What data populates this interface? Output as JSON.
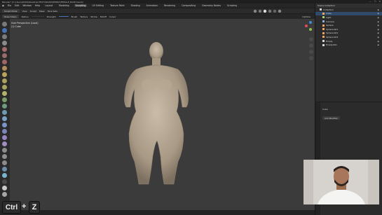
{
  "window": {
    "title": "Blender* [C:\\Users\\DUMA\\Desktop\\TEXTURA\\MUDERNO\\FEMALE_BASE.blend]",
    "controls": [
      "—",
      "☐",
      "✕"
    ]
  },
  "menu": {
    "items": [
      "File",
      "Edit",
      "Window",
      "Help"
    ],
    "workspaces": [
      "Layout",
      "Modeling",
      "Sculpting",
      "UV Editing",
      "Texture Paint",
      "Shading",
      "Animation",
      "Rendering",
      "Compositing",
      "Geometry Nodes",
      "Scripting"
    ],
    "active_workspace": "Sculpting",
    "scene": "Scene",
    "view_layer": "ViewLayer"
  },
  "header1": {
    "mode": "Sculpt Mode",
    "items": [
      "View",
      "Sculpt",
      "Mask",
      "Face Sets"
    ]
  },
  "header2": {
    "brush": "Draw Sharp",
    "radius_label": "Radius",
    "strength_label": "Strength",
    "items": [
      "Brush",
      "Texture",
      "Stroke",
      "Falloff",
      "Cursor"
    ],
    "view_label": "Options"
  },
  "viewport": {
    "info_line1": "User Perspective (Local)",
    "info_line2": "(1) Cube"
  },
  "outliner": {
    "title": "Scene Collection",
    "rows": [
      {
        "label": "Collection",
        "icon_color": "#d4d4d4",
        "selected": false
      },
      {
        "label": "Cube",
        "icon_color": "#f0a35e",
        "selected": true
      },
      {
        "label": "Light",
        "icon_color": "#a8d27a",
        "selected": false
      },
      {
        "label": "Camera",
        "icon_color": "#8fb1d8",
        "selected": false
      },
      {
        "label": "Sphere",
        "icon_color": "#f0a35e",
        "selected": false
      },
      {
        "label": "Sphere.001",
        "icon_color": "#f0a35e",
        "selected": false
      },
      {
        "label": "Sphere.002",
        "icon_color": "#f0a35e",
        "selected": false
      },
      {
        "label": "Sphere.003",
        "icon_color": "#f0a35e",
        "selected": false
      },
      {
        "label": "Empty",
        "icon_color": "#d4d4d4",
        "selected": false
      },
      {
        "label": "Empty.001",
        "icon_color": "#d4d4d4",
        "selected": false
      }
    ]
  },
  "properties": {
    "object_name": "Cube",
    "section": "Add Modifier"
  },
  "keys": {
    "ctrl": "Ctrl",
    "plus": "+",
    "z": "Z"
  },
  "colors": {
    "viewport_bg": "#3b3b3b",
    "panel_bg": "#2b2b2b",
    "accent": "#2f4a6a",
    "model": "#b3a592"
  }
}
